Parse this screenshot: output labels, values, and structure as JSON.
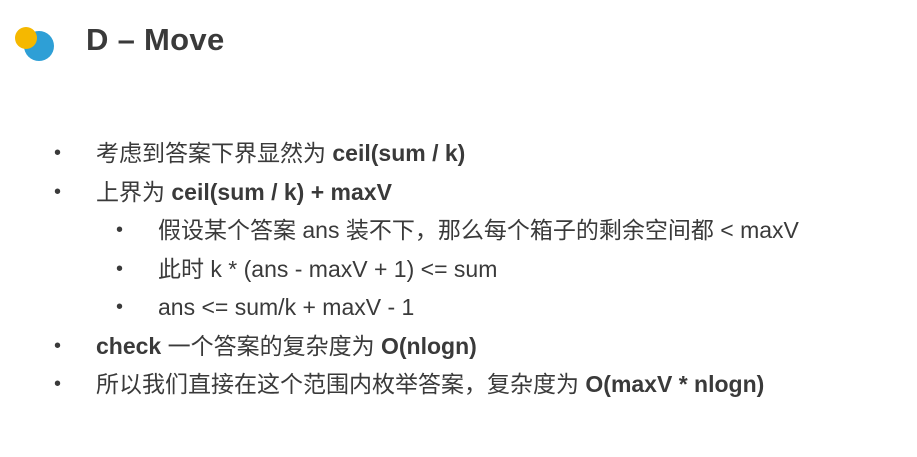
{
  "slide": {
    "title": "D – Move",
    "bullets": [
      {
        "level": 1,
        "parts": [
          {
            "text": "考虑到答案下界显然为 ",
            "bold": false
          },
          {
            "text": "ceil(sum / k)",
            "bold": true
          }
        ]
      },
      {
        "level": 1,
        "parts": [
          {
            "text": "上界为 ",
            "bold": false
          },
          {
            "text": "ceil(sum / k) + maxV",
            "bold": true
          }
        ]
      },
      {
        "level": 2,
        "parts": [
          {
            "text": "假设某个答案 ans 装不下，那么每个箱子的剩余空间都 < maxV",
            "bold": false
          }
        ]
      },
      {
        "level": 2,
        "parts": [
          {
            "text": "此时 k * (ans - maxV + 1) <= sum",
            "bold": false
          }
        ]
      },
      {
        "level": 2,
        "parts": [
          {
            "text": "ans <= sum/k + maxV - 1",
            "bold": false
          }
        ]
      },
      {
        "level": 1,
        "parts": [
          {
            "text": "check",
            "bold": true
          },
          {
            "text": " 一个答案的复杂度为 ",
            "bold": false
          },
          {
            "text": "O(nlogn)",
            "bold": true
          }
        ]
      },
      {
        "level": 1,
        "parts": [
          {
            "text": "所以我们直接在这个范围内枚举答案，复杂度为 ",
            "bold": false
          },
          {
            "text": "O(maxV * nlogn)",
            "bold": true
          }
        ]
      }
    ],
    "bullet_glyph": "•"
  },
  "colors": {
    "logo_yellow": "#f5b800",
    "logo_blue": "#2e9fd6",
    "text": "#3a3a3a"
  },
  "icons": {
    "logo": "two-overlapping-circles-icon"
  }
}
